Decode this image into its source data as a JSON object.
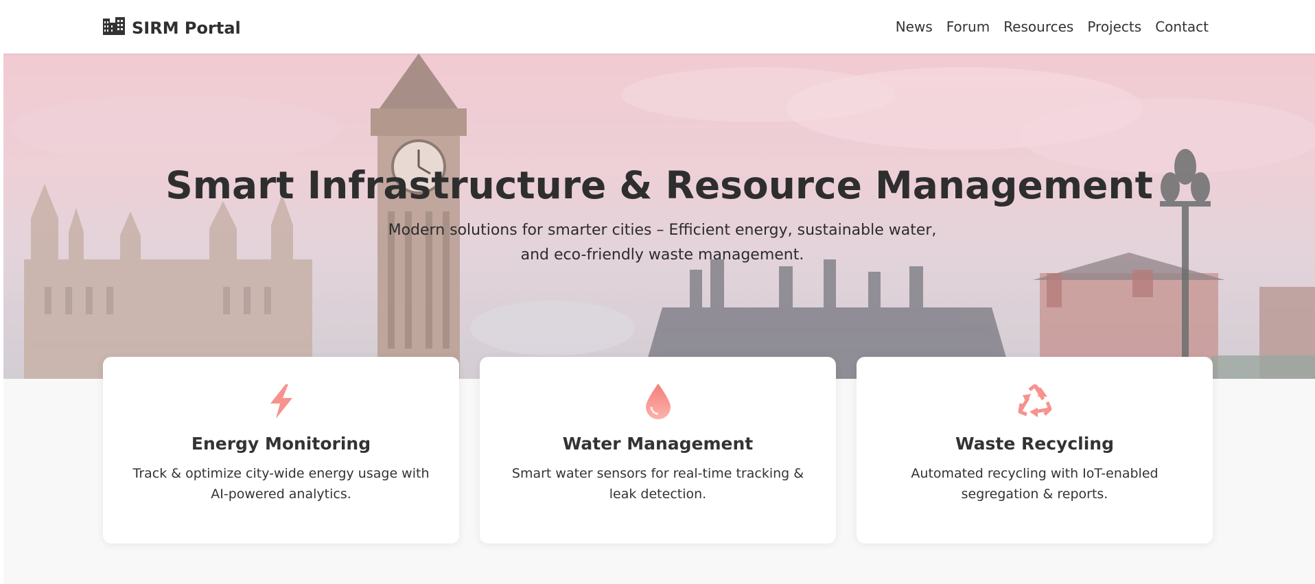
{
  "navbar": {
    "brand_icon": "city-buildings-icon",
    "brand_name": "SIRM Portal",
    "links": [
      "News",
      "Forum",
      "Resources",
      "Projects",
      "Contact"
    ]
  },
  "hero": {
    "title": "Smart Infrastructure & Resource Management",
    "subtitle": "Modern solutions for smarter cities – Efficient energy, sustainable water, and eco-friendly waste management."
  },
  "cards": [
    {
      "icon": "lightning-bolt-icon",
      "title": "Energy Monitoring",
      "description": "Track & optimize city-wide energy usage with AI-powered analytics."
    },
    {
      "icon": "water-drop-icon",
      "title": "Water Management",
      "description": "Smart water sensors for real-time tracking & leak detection."
    },
    {
      "icon": "recycle-icon",
      "title": "Waste Recycling",
      "description": "Automated recycling with IoT-enabled segregation & reports."
    }
  ],
  "colors": {
    "accent": "#f7928e",
    "accent_light": "#fbb2a9",
    "text": "#333333",
    "hero_tint": "#f1c9d0"
  }
}
